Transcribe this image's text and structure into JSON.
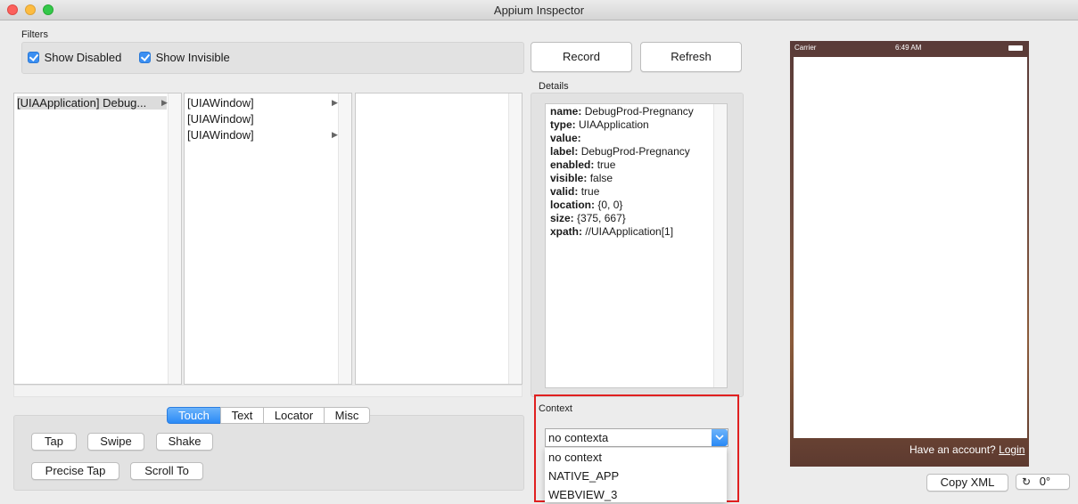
{
  "window": {
    "title": "Appium Inspector"
  },
  "filters": {
    "label": "Filters",
    "show_disabled": "Show Disabled",
    "show_invisible": "Show Invisible"
  },
  "toolbar": {
    "record": "Record",
    "refresh": "Refresh"
  },
  "tree": {
    "col1": [
      {
        "label": "[UIAApplication] Debug...",
        "has_children": true
      }
    ],
    "col2": [
      {
        "label": "[UIAWindow]",
        "has_children": true
      },
      {
        "label": "[UIAWindow]",
        "has_children": false
      },
      {
        "label": "[UIAWindow]",
        "has_children": true
      }
    ]
  },
  "details": {
    "label": "Details",
    "lines": [
      {
        "key": "name:",
        "value": "DebugProd-Pregnancy"
      },
      {
        "key": "type:",
        "value": "UIAApplication"
      },
      {
        "key": "value:",
        "value": ""
      },
      {
        "key": "label:",
        "value": "DebugProd-Pregnancy"
      },
      {
        "key": "enabled:",
        "value": "true"
      },
      {
        "key": "visible:",
        "value": "false"
      },
      {
        "key": "valid:",
        "value": "true"
      },
      {
        "key": "location:",
        "value": "{0, 0}"
      },
      {
        "key": "size:",
        "value": "{375, 667}"
      },
      {
        "key": "xpath:",
        "value": "//UIAApplication[1]"
      }
    ]
  },
  "action_tabs": [
    "Touch",
    "Text",
    "Locator",
    "Misc"
  ],
  "touch_buttons": {
    "tap": "Tap",
    "swipe": "Swipe",
    "shake": "Shake",
    "precise_tap": "Precise Tap",
    "scroll_to": "Scroll To"
  },
  "context": {
    "label": "Context",
    "input_value": "no contexta",
    "options": [
      "no context",
      "NATIVE_APP",
      "WEBVIEW_3"
    ],
    "highlight_color": "#e02020"
  },
  "phone": {
    "carrier": "Carrier",
    "time": "6:49 AM",
    "footer_text": "Have an account?",
    "login_link": "Login"
  },
  "bottom": {
    "copy_xml": "Copy XML",
    "rotation": "0°"
  }
}
